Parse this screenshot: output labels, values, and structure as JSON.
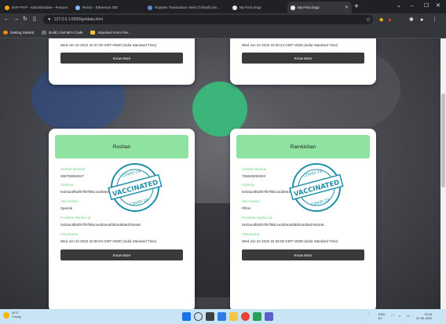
{
  "browser": {
    "tabs": [
      {
        "title": "DVP-PVP - Administrative - Posture",
        "active": false
      },
      {
        "title": "Remix - Ethereum IDE",
        "active": false
      },
      {
        "title": "Ropsten Transaction Hash (Txhash) De...",
        "active": false
      },
      {
        "title": "My First dApp",
        "active": false
      },
      {
        "title": "My First dApp",
        "active": true
      }
    ],
    "url": "127.0.0.1:5500/getdata.html",
    "bookmarks": [
      "Getting Started",
      "Build | Get MFA Code",
      "Imported From Fire..."
    ]
  },
  "cards_top": [
    {
      "timestamp": "Wed Jun 22 2022 22:37:00 GMT+0530 (India Standard Time)",
      "button": "Know More"
    },
    {
      "timestamp": "Wed Jun 22 2022 22:30:24 GMT+0530 (India Standard Time)",
      "button": "Know More"
    }
  ],
  "cards": [
    {
      "name": "Roshan",
      "aadhar_label": "Aadhar Number",
      "aadhar": "458765654527",
      "address_label": "Address",
      "address": "0x02ac8f52f67f07f9bc1e2b0e4dd5...",
      "vaccination_label": "Vaccination",
      "vaccination": "Sputnik",
      "worker_label": "Frontline Worker Id",
      "worker": "0x02ac8f52f67f07f9bc1e2b0e4d0bb440b6d763448",
      "timestamp_label": "Timestamp",
      "timestamp": "Wed Jun 22 2022 22:36:04 GMT+0530 (India Standard Time)",
      "button": "Know More"
    },
    {
      "name": "Ramkishan",
      "aadhar_label": "Aadhar Number",
      "aadhar": "755648293253",
      "address_label": "Address",
      "address": "0x02ac8f52f67f07f9bc1e2b0e4...",
      "vaccination_label": "Vaccination",
      "vaccination": "Pfizer",
      "worker_label": "Frontline Worker Id",
      "worker": "0x02ac8f52f67f07f9bc1e2b0e4dd5bb440b6d763448",
      "timestamp_label": "Timestamp",
      "timestamp": "Wed Jun 22 2022 22:35:06 GMT+0530 (India Standard Time)",
      "button": "Know More"
    }
  ],
  "stamp": {
    "text": "VACCINATED",
    "arc_top": "COVID-19",
    "arc_bottom": "COVID-19"
  },
  "taskbar": {
    "weather_temp": "34°C",
    "weather_desc": "Cloudy",
    "lang": "ENG",
    "region": "IN",
    "time": "22:44",
    "date": "22-06-2022"
  },
  "colors": {
    "accent_green": "#8fe3a0",
    "label_green": "#6ccf82",
    "button_dark": "#3a3a3a"
  }
}
